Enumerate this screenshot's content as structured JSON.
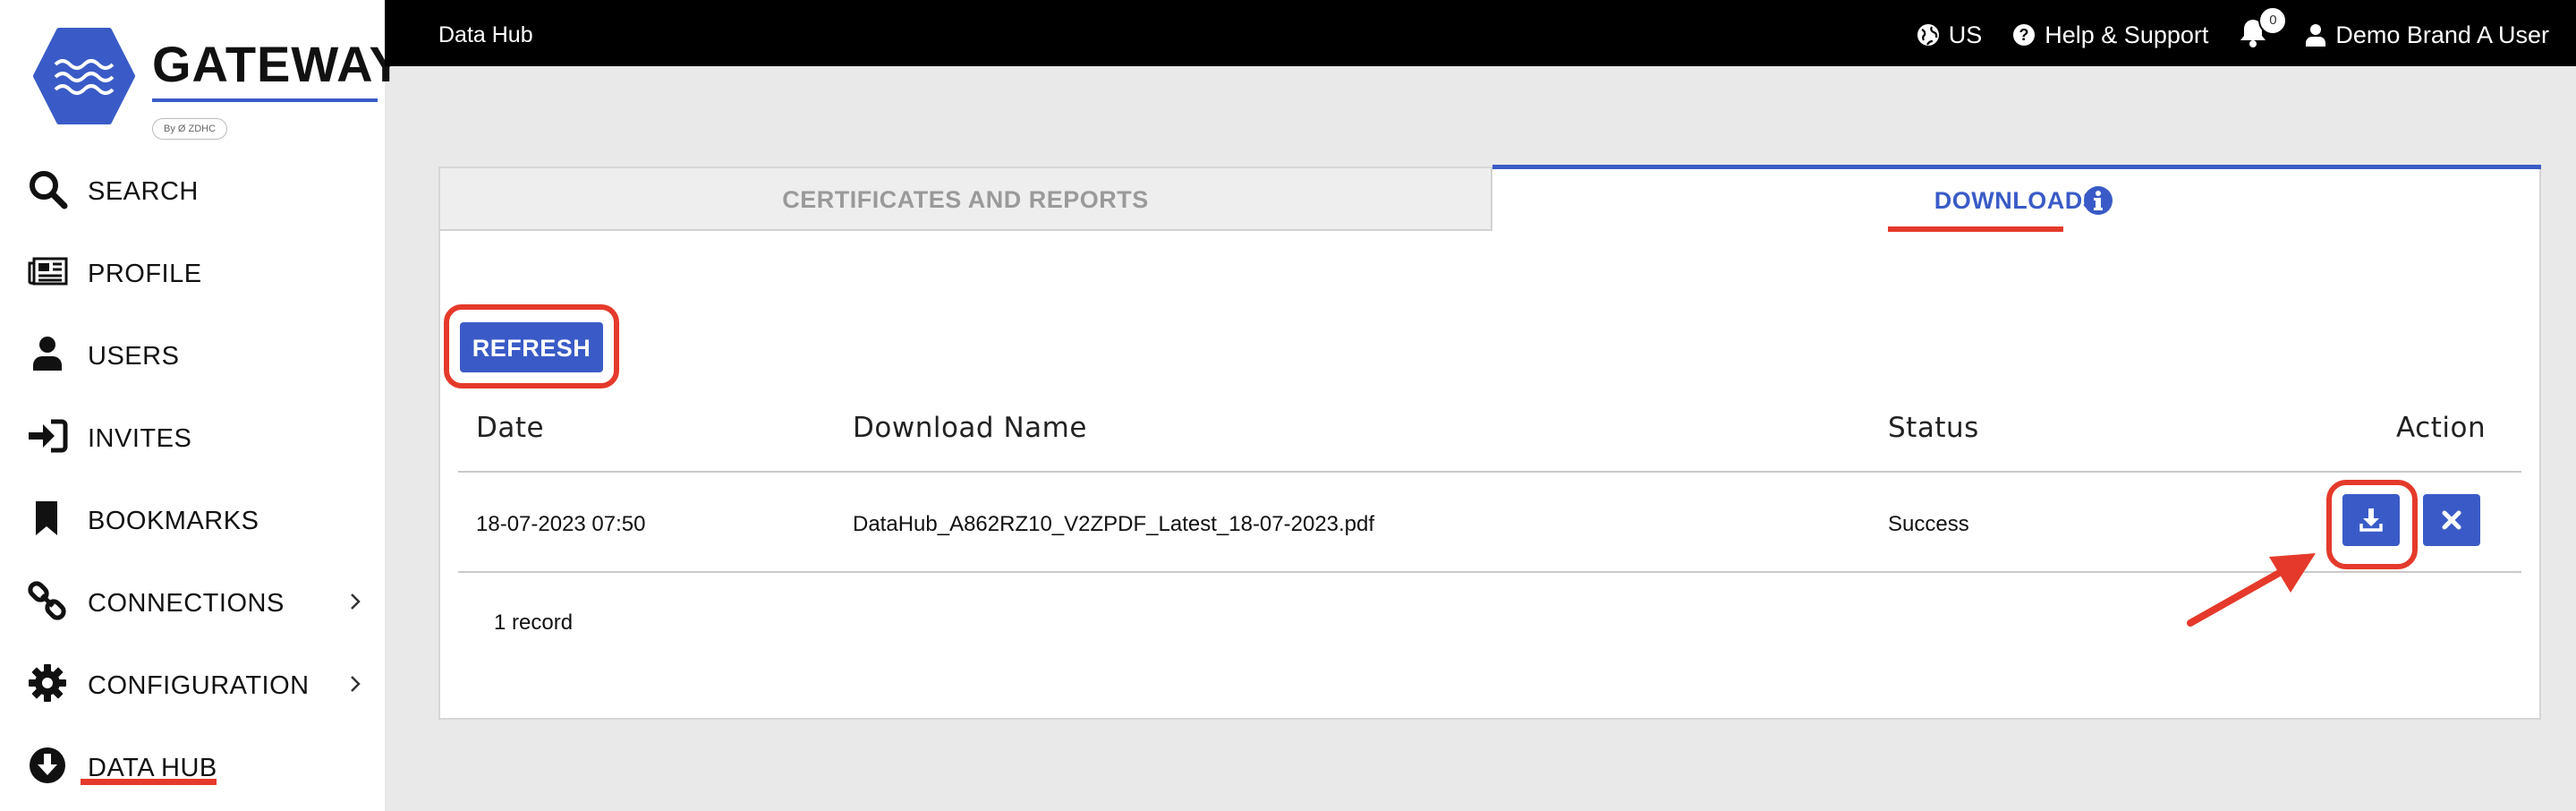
{
  "brand": {
    "name": "GATEWAY",
    "tagline": "By Ø ZDHC"
  },
  "sidebar": {
    "items": [
      {
        "label": "SEARCH",
        "icon": "search-icon",
        "has_chevron": false
      },
      {
        "label": "PROFILE",
        "icon": "newspaper-icon",
        "has_chevron": false
      },
      {
        "label": "USERS",
        "icon": "user-icon",
        "has_chevron": false
      },
      {
        "label": "INVITES",
        "icon": "sign-in-icon",
        "has_chevron": false
      },
      {
        "label": "BOOKMARKS",
        "icon": "bookmark-icon",
        "has_chevron": false
      },
      {
        "label": "CONNECTIONS",
        "icon": "link-icon",
        "has_chevron": true
      },
      {
        "label": "CONFIGURATION",
        "icon": "gear-icon",
        "has_chevron": true
      },
      {
        "label": "DATA HUB",
        "icon": "download-circle-icon",
        "has_chevron": false,
        "highlighted": true
      }
    ]
  },
  "topbar": {
    "title": "Data Hub",
    "region": "US",
    "help": "Help & Support",
    "notifications_count": "0",
    "user": "Demo Brand A User"
  },
  "tabs": {
    "left": "CERTIFICATES AND REPORTS",
    "right": "DOWNLOADS",
    "active": "DOWNLOADS"
  },
  "actions": {
    "refresh": "REFRESH"
  },
  "table": {
    "headers": [
      "Date",
      "Download Name",
      "Status",
      "Action"
    ],
    "rows": [
      {
        "date": "18-07-2023 07:50",
        "name": "DataHub_A862RZ10_V2ZPDF_Latest_18-07-2023.pdf",
        "status": "Success"
      }
    ],
    "record_count": "1 record"
  },
  "colors": {
    "accent": "#3a5bc7",
    "highlight": "#e53a2b",
    "topbar": "#000000"
  }
}
